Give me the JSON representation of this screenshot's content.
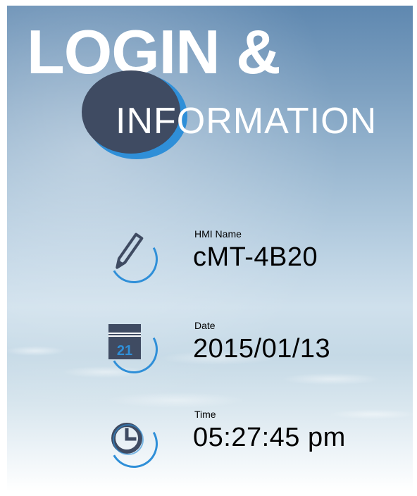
{
  "header": {
    "title_line1": "LOGIN &",
    "title_line2": "INFORMATION"
  },
  "fields": [
    {
      "label": "HMI Name",
      "value": "cMT-4B20",
      "icon": "pencil-icon"
    },
    {
      "label": "Date",
      "value": "2015/01/13",
      "icon": "calendar-icon",
      "icon_text": "21"
    },
    {
      "label": "Time",
      "value": "05:27:45 pm",
      "icon": "clock-icon"
    }
  ],
  "colors": {
    "accent": "#2f8fd8",
    "icon_fill": "#3f4b62",
    "sky_top": "#5f88b0",
    "text": "#000000",
    "title": "#ffffff"
  }
}
